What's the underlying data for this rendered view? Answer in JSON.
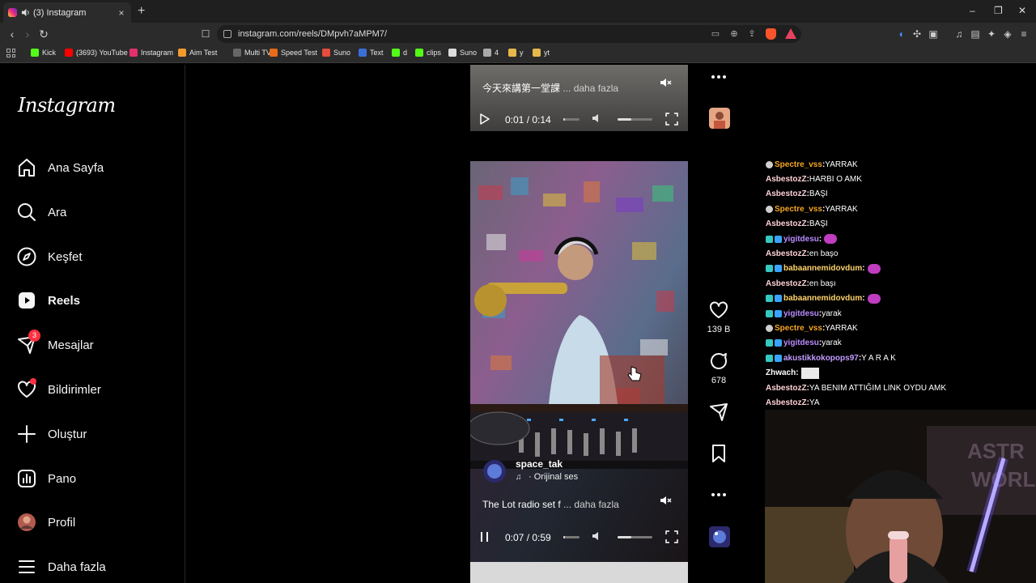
{
  "browser": {
    "tab_title": "(3) Instagram",
    "tab_close": "×",
    "new_tab": "+",
    "url": "instagram.com/reels/DMpvh7aMPM7/",
    "window_controls": [
      "–",
      "❐",
      "✕"
    ],
    "bookmarks": [
      {
        "label": "Kick",
        "color": "#53fc18"
      },
      {
        "label": "(3693) YouTube",
        "color": "#ff0000"
      },
      {
        "label": "Instagram",
        "color": "#e1306c"
      },
      {
        "label": "Aim Test",
        "color": "#f29a2e"
      },
      {
        "label": "Multi TV",
        "color": "#666666"
      },
      {
        "label": "Speed Test",
        "color": "#e86a1a"
      },
      {
        "label": "Suno",
        "color": "#e74c3c"
      },
      {
        "label": "Text",
        "color": "#3b6fd8"
      },
      {
        "label": "d",
        "color": "#53fc18"
      },
      {
        "label": "clips",
        "color": "#53fc18"
      },
      {
        "label": "Suno",
        "color": "#dddddd"
      },
      {
        "label": "4",
        "color": "#aaaaaa"
      },
      {
        "label": "y",
        "color": "#e6b84a"
      },
      {
        "label": "yt",
        "color": "#e6b84a"
      }
    ]
  },
  "instagram": {
    "logo": "Instagram",
    "nav": [
      {
        "label": "Ana Sayfa",
        "icon": "home-icon"
      },
      {
        "label": "Ara",
        "icon": "search-icon"
      },
      {
        "label": "Keşfet",
        "icon": "explore-icon"
      },
      {
        "label": "Reels",
        "icon": "reels-icon",
        "active": true
      },
      {
        "label": "Mesajlar",
        "icon": "messages-icon",
        "badge": "3"
      },
      {
        "label": "Bildirimler",
        "icon": "heart-icon"
      },
      {
        "label": "Oluştur",
        "icon": "plus-icon"
      },
      {
        "label": "Pano",
        "icon": "dashboard-icon"
      },
      {
        "label": "Profil",
        "icon": "avatar"
      },
      {
        "label": "Daha fazla",
        "icon": "menu-icon"
      }
    ],
    "reel_top": {
      "caption": "今天來講第一堂課",
      "more": "... daha fazla",
      "time": "0:01 / 0:14",
      "progress": 0.07
    },
    "reel_main": {
      "username": "space_tak",
      "audio": "· Orijinal ses",
      "caption": "The Lot radio set f",
      "more": "... daha fazla",
      "time": "0:07 / 0:59",
      "progress": 0.12,
      "likes": "139 B",
      "comments": "678"
    }
  },
  "chat": [
    {
      "user": "Spectre_vss",
      "color": "#f5a623",
      "icon": "skull",
      "msg": "YARRAK"
    },
    {
      "user": "AsbestozZ",
      "color": "#ffd0d6",
      "icon": "",
      "msg": "HARBI O AMK"
    },
    {
      "user": "AsbestozZ",
      "color": "#ffd0d6",
      "icon": "",
      "msg": "BAŞI"
    },
    {
      "user": "Spectre_vss",
      "color": "#f5a623",
      "icon": "skull",
      "msg": "YARRAK"
    },
    {
      "user": "AsbestozZ",
      "color": "#ffd0d6",
      "icon": "",
      "msg": "BAŞI"
    },
    {
      "user": "yigitdesu",
      "color": "#b98cff",
      "icon": "badge",
      "msg": "",
      "emote": true
    },
    {
      "user": "AsbestozZ",
      "color": "#ffd0d6",
      "icon": "",
      "msg": "en başo"
    },
    {
      "user": "babaannemidovdum",
      "color": "#ffd36b",
      "icon": "badge",
      "msg": "",
      "emote": true
    },
    {
      "user": "AsbestozZ",
      "color": "#ffd0d6",
      "icon": "",
      "msg": "en başı"
    },
    {
      "user": "babaannemidovdum",
      "color": "#ffd36b",
      "icon": "badge",
      "msg": "",
      "emote": true
    },
    {
      "user": "yigitdesu",
      "color": "#b98cff",
      "icon": "badge",
      "msg": "yarak"
    },
    {
      "user": "Spectre_vss",
      "color": "#f5a623",
      "icon": "skull",
      "msg": "YARRAK"
    },
    {
      "user": "yigitdesu",
      "color": "#b98cff",
      "icon": "badge",
      "msg": "yarak"
    },
    {
      "user": "akustikkokopops97",
      "color": "#c39cff",
      "icon": "badge",
      "msg": "Y A R A K"
    },
    {
      "user": "Zhwach",
      "color": "#ffffff",
      "icon": "",
      "msg": "",
      "image": true
    },
    {
      "user": "AsbestozZ",
      "color": "#ffd0d6",
      "icon": "",
      "msg": "YA BENIM ATTIĞIM LINK OYDU AMK"
    },
    {
      "user": "AsbestozZ",
      "color": "#ffd0d6",
      "icon": "",
      "msg": "YA"
    }
  ]
}
